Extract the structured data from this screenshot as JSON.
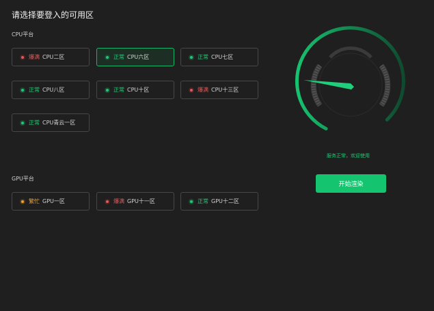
{
  "page": {
    "title": "请选择要登入的可用区"
  },
  "status_colors": {
    "normal": "#22c776",
    "full": "#e05a5a",
    "busy": "#f0a132",
    "accent": "#14c46f"
  },
  "cpu_section": {
    "label": "CPU平台",
    "zones": [
      {
        "status": "爆满",
        "name": "CPU二区",
        "state": "full",
        "selected": false
      },
      {
        "status": "正常",
        "name": "CPU六区",
        "state": "normal",
        "selected": true
      },
      {
        "status": "正常",
        "name": "CPU七区",
        "state": "normal",
        "selected": false
      },
      {
        "status": "正常",
        "name": "CPU八区",
        "state": "normal",
        "selected": false
      },
      {
        "status": "正常",
        "name": "CPU十区",
        "state": "normal",
        "selected": false
      },
      {
        "status": "爆满",
        "name": "CPU十三区",
        "state": "full",
        "selected": false
      },
      {
        "status": "正常",
        "name": "CPU青云一区",
        "state": "normal",
        "selected": false
      }
    ]
  },
  "gpu_section": {
    "label": "GPU平台",
    "zones": [
      {
        "status": "繁忙",
        "name": "GPU一区",
        "state": "busy",
        "selected": false
      },
      {
        "status": "爆满",
        "name": "GPU十一区",
        "state": "full",
        "selected": false
      },
      {
        "status": "正常",
        "name": "GPU十二区",
        "state": "normal",
        "selected": false
      }
    ]
  },
  "gauge": {
    "message": "服务正常，欢迎使用",
    "icon": "speedometer-icon"
  },
  "actions": {
    "start_label": "开始渲染"
  }
}
